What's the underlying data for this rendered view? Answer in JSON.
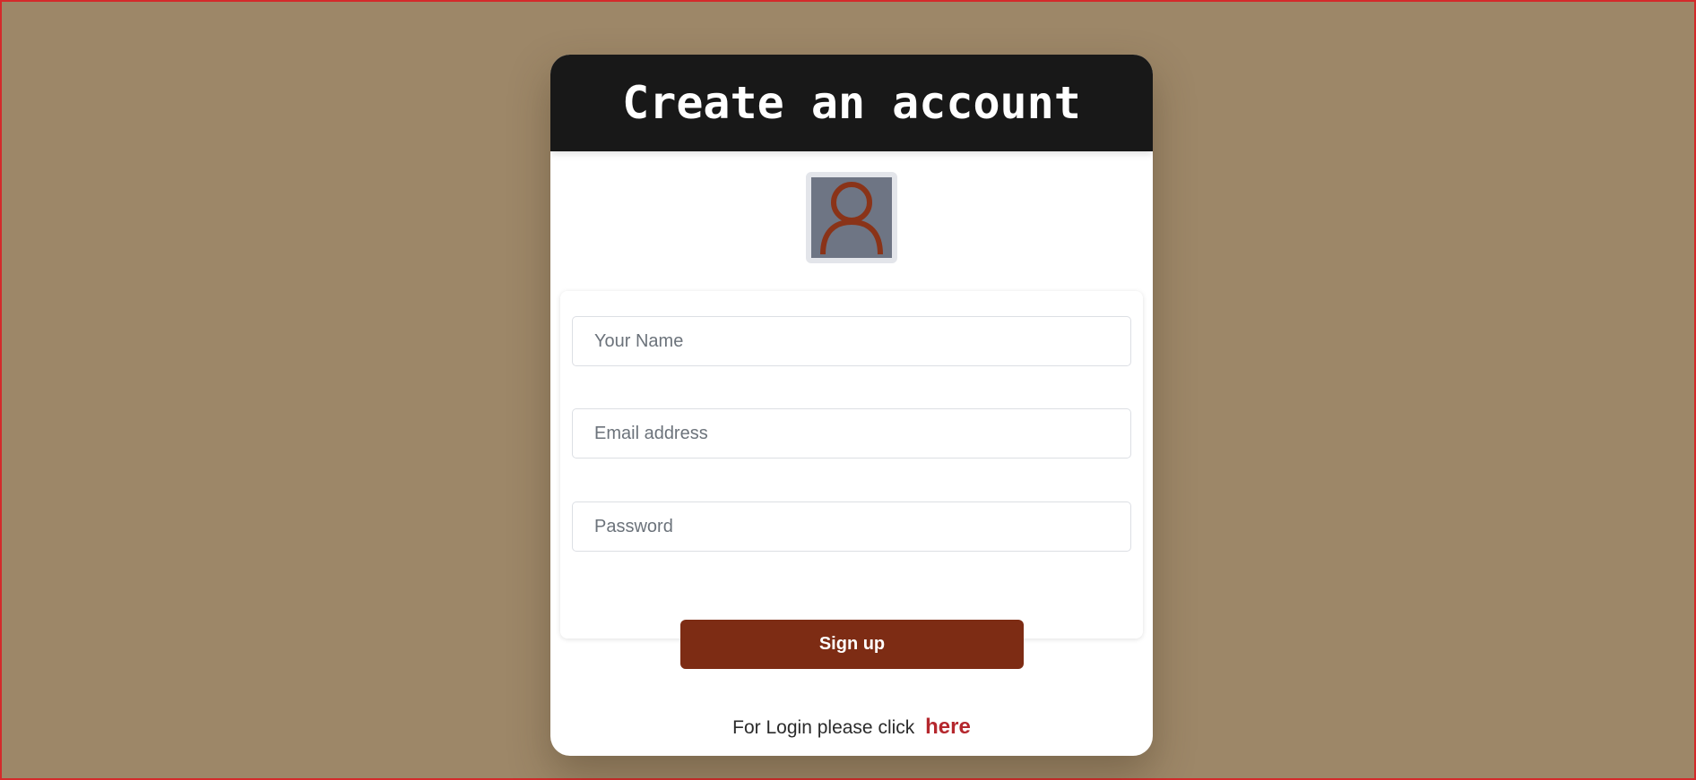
{
  "colors": {
    "background": "#9d8768",
    "header": "#181818",
    "accent_button": "#7d2c14",
    "link": "#b5272d",
    "avatar_bg": "#6e7584",
    "avatar_icon": "#8a3318"
  },
  "header": {
    "title": "Create an account"
  },
  "avatar": {
    "icon": "user-icon"
  },
  "form": {
    "name_placeholder": "Your Name",
    "name_value": "",
    "email_placeholder": "Email address",
    "email_value": "",
    "password_placeholder": "Password",
    "password_value": ""
  },
  "actions": {
    "signup_label": "Sign up"
  },
  "footer": {
    "login_prompt": "For Login please click",
    "login_link": "here"
  }
}
